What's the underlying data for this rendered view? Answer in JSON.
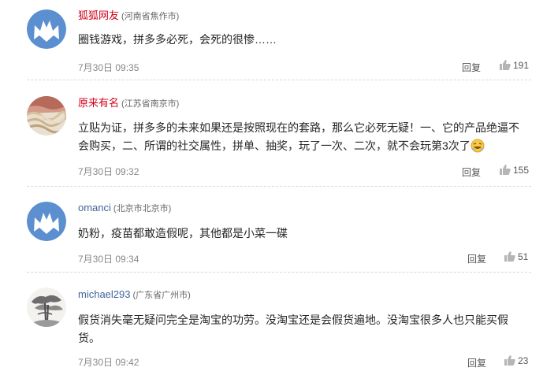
{
  "comments": [
    {
      "user": "狐狐网友",
      "location": "(河南省焦作市)",
      "text": "圈钱游戏，拼多多必死，会死的很惨……",
      "date": "7月30日 09:35",
      "reply_label": "回复",
      "likes": "191",
      "avatar": "default-avatar-icon"
    },
    {
      "user": "原来有名",
      "location": "(江苏省南京市)",
      "text": "立贴为证，拼多多的未来如果还是按照现在的套路，那么它必死无疑！一、它的产品绝逼不会购买，二、所谓的社交属性，拼单、抽奖，玩了一次、二次，就不会玩第3次了",
      "date": "7月30日 09:32",
      "reply_label": "回复",
      "likes": "155",
      "avatar": "noodle-photo-avatar"
    },
    {
      "user": "omanci",
      "location": "(北京市北京市)",
      "text": "奶粉，疫苗都敢造假呢，其他都是小菜一碟",
      "date": "7月30日 09:34",
      "reply_label": "回复",
      "likes": "51",
      "avatar": "default-avatar-icon"
    },
    {
      "user": "michael293",
      "location": "(广东省广州市)",
      "text": "假货消失毫无疑问完全是淘宝的功劳。没淘宝还是会假货遍地。没淘宝很多人也只能买假货。",
      "date": "7月30日 09:42",
      "reply_label": "回复",
      "likes": "23",
      "avatar": "ink-tree-painting-avatar"
    }
  ],
  "colors": {
    "username_red": "#d0021b",
    "username_blue": "#406599",
    "default_avatar": "#5b8fd0",
    "meta_gray": "#888888"
  }
}
